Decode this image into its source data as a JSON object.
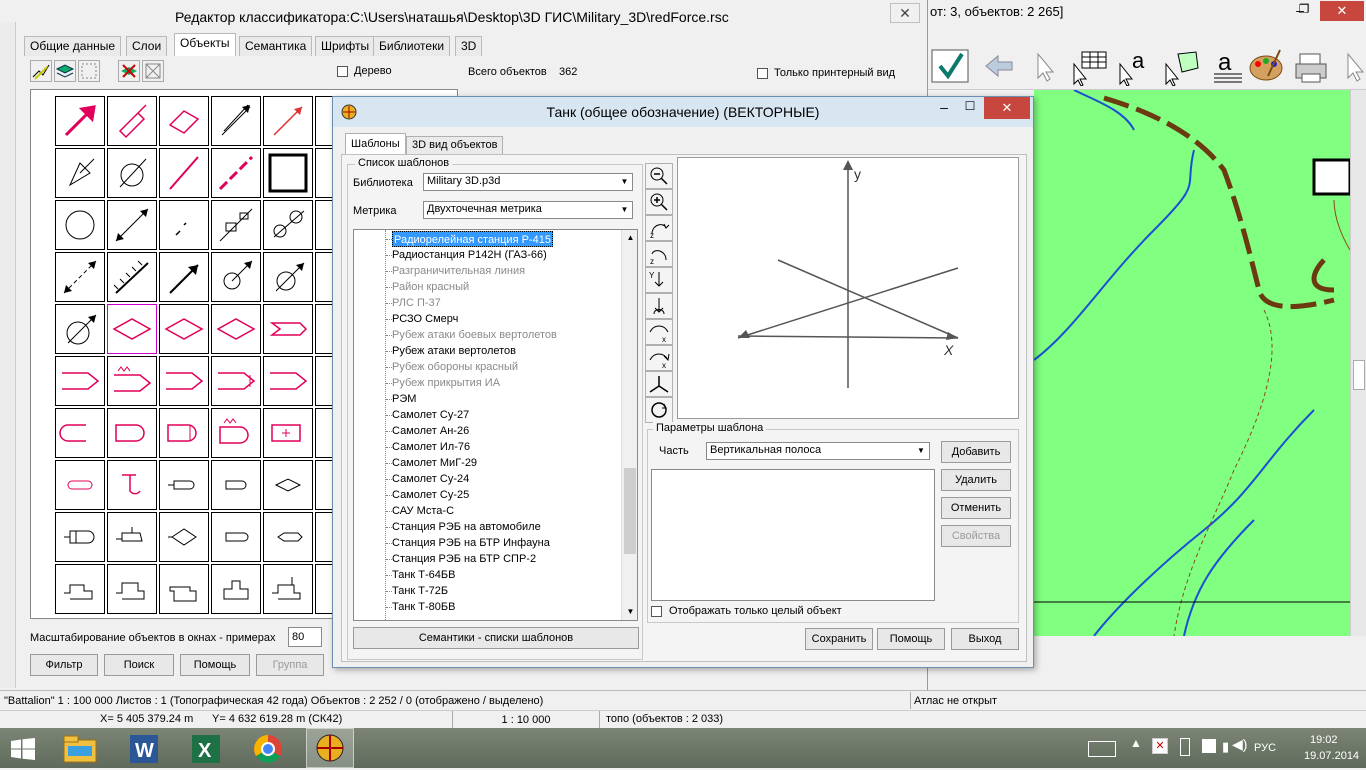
{
  "classifier_window": {
    "title": "Редактор классификатора:C:\\Users\\наташья\\Desktop\\3D ГИС\\Military_3D\\redForce.rsc",
    "tabs": [
      "Общие данные",
      "Слои",
      "Объекты",
      "Семантика",
      "Шрифты",
      "Библиотеки",
      "3D"
    ],
    "active_tab": "Объекты",
    "tree_checkbox_label": "Дерево",
    "total_objects_label": "Всего объектов",
    "total_objects_value": "362",
    "printer_only_label": "Только принтерный вид",
    "scale_label": "Масштабирование объектов в окнах - примерах",
    "scale_value": "80",
    "buttons": {
      "filter": "Фильтр",
      "search": "Поиск",
      "help": "Помощь",
      "group": "Группа"
    }
  },
  "main_window": {
    "title_fragment": "от: 3, объектов: 2 265]",
    "toolbar_icons": [
      "check-icon",
      "arrow-left-icon",
      "select-arrow-icon",
      "table-select-icon",
      "text-select-icon",
      "polygon-select-icon",
      "text-tool-icon",
      "palette-icon",
      "printer-icon",
      "arrow-right-icon"
    ]
  },
  "template_dialog": {
    "title": "Танк (общее обозначение) (ВЕКТОРНЫЕ)",
    "tabs": [
      "Шаблоны",
      "3D вид объектов"
    ],
    "active_tab": "Шаблоны",
    "list_group_label": "Список шаблонов",
    "library_label": "Библиотека",
    "library_value": "Military 3D.p3d",
    "metric_label": "Метрика",
    "metric_value": "Двухточечная метрика",
    "items": [
      {
        "label": "Радиорелейная станция  Р-415",
        "state": "selected"
      },
      {
        "label": "Радиостанция Р142Н (ГАЗ-66)",
        "state": "normal"
      },
      {
        "label": "Разграничительная линия",
        "state": "gray"
      },
      {
        "label": "Район красный",
        "state": "gray"
      },
      {
        "label": "РЛС П-37",
        "state": "gray"
      },
      {
        "label": "РСЗО Смерч",
        "state": "normal"
      },
      {
        "label": "Рубеж атаки боевых вертолетов",
        "state": "gray"
      },
      {
        "label": "Рубеж атаки вертолетов",
        "state": "normal"
      },
      {
        "label": "Рубеж обороны красный",
        "state": "gray"
      },
      {
        "label": "Рубеж прикрытия ИА",
        "state": "gray"
      },
      {
        "label": "РЭМ",
        "state": "normal"
      },
      {
        "label": "Самолет Су-27",
        "state": "normal"
      },
      {
        "label": "Самолет Ан-26",
        "state": "normal"
      },
      {
        "label": "Самолет Ил-76",
        "state": "normal"
      },
      {
        "label": "Самолет МиГ-29",
        "state": "normal"
      },
      {
        "label": "Самолет Су-24",
        "state": "normal"
      },
      {
        "label": "Самолет Су-25",
        "state": "normal"
      },
      {
        "label": "САУ Мста-С",
        "state": "normal"
      },
      {
        "label": "Станция РЭБ на автомобиле",
        "state": "normal"
      },
      {
        "label": "Станция РЭБ на БТР Инфауна",
        "state": "normal"
      },
      {
        "label": "Станция РЭБ на БТР СПР-2",
        "state": "normal"
      },
      {
        "label": "Танк Т-64БВ",
        "state": "normal"
      },
      {
        "label": "Танк Т-72Б",
        "state": "normal"
      },
      {
        "label": "Танк Т-80БВ",
        "state": "normal"
      }
    ],
    "semantics_button": "Семантики - списки шаблонов",
    "axis_x": "X",
    "axis_y": "y",
    "params_group_label": "Параметры шаблона",
    "part_label": "Часть",
    "part_value": "Вертикальная полоса",
    "buttons": {
      "add": "Добавить",
      "delete": "Удалить",
      "cancel": "Отменить",
      "properties": "Свойства",
      "save": "Сохранить",
      "help": "Помощь",
      "exit": "Выход"
    },
    "whole_object_label": "Отображать только целый объект"
  },
  "status_bar": {
    "row1_main": "\"Battalion\"  1 : 100 000   Листов : 1   (Топографическая 42 года)  Объектов : 2 252 / 0 (отображено / выделено)",
    "row1_right": "Атлас не открыт",
    "x_coord": "X= 5 405 379.24 m",
    "y_coord": "Y= 4 632 619.28 m  (СК42)",
    "scale": "1 : 10 000",
    "layer": "топо   (объектов : 2 033)"
  },
  "taskbar": {
    "lang": "РУС",
    "time": "19:02",
    "date": "19.07.2014",
    "apps": [
      "windows-start-icon",
      "file-explorer-icon",
      "word-icon",
      "excel-icon",
      "chrome-icon",
      "gis-map-icon"
    ]
  },
  "colors": {
    "map_green": "#80ff80",
    "road_brown": "#6b3a10",
    "river_blue": "#1a4fd6",
    "symbol_magenta": "#e0005a",
    "selection_blue": "#3399ff",
    "taskbar_bg": "#6f7a6a"
  }
}
